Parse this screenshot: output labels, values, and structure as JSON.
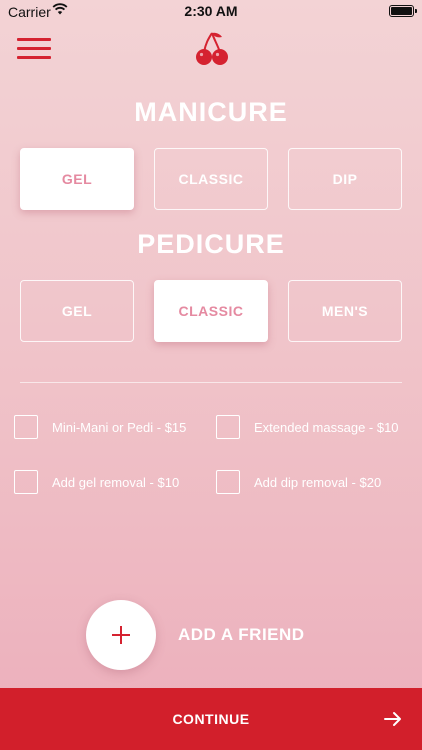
{
  "status_bar": {
    "carrier": "Carrier",
    "time": "2:30 AM",
    "wifi_icon": "wifi-icon",
    "battery_icon": "battery-icon"
  },
  "header": {
    "menu_icon": "hamburger-menu-icon",
    "logo_icon": "cherry-icon"
  },
  "manicure": {
    "title": "MANICURE",
    "options": [
      {
        "label": "GEL",
        "selected": true
      },
      {
        "label": "CLASSIC",
        "selected": false
      },
      {
        "label": "DIP",
        "selected": false
      }
    ]
  },
  "pedicure": {
    "title": "PEDICURE",
    "options": [
      {
        "label": "GEL",
        "selected": false
      },
      {
        "label": "CLASSIC",
        "selected": true
      },
      {
        "label": "MEN'S",
        "selected": false
      }
    ]
  },
  "addons": [
    {
      "label": "Mini-Mani or Pedi - $15",
      "checked": false
    },
    {
      "label": "Extended massage - $10",
      "checked": false
    },
    {
      "label": "Add gel removal - $10",
      "checked": false
    },
    {
      "label": "Add dip removal - $20",
      "checked": false
    }
  ],
  "add_friend": {
    "label": "ADD A FRIEND",
    "icon": "plus-icon"
  },
  "continue": {
    "label": "CONTINUE",
    "icon": "arrow-right-icon"
  },
  "colors": {
    "accent": "#d21f2b",
    "selected_text": "#e58aa1",
    "background_top": "#f3d3d5",
    "background_bottom": "#ecaebb"
  }
}
